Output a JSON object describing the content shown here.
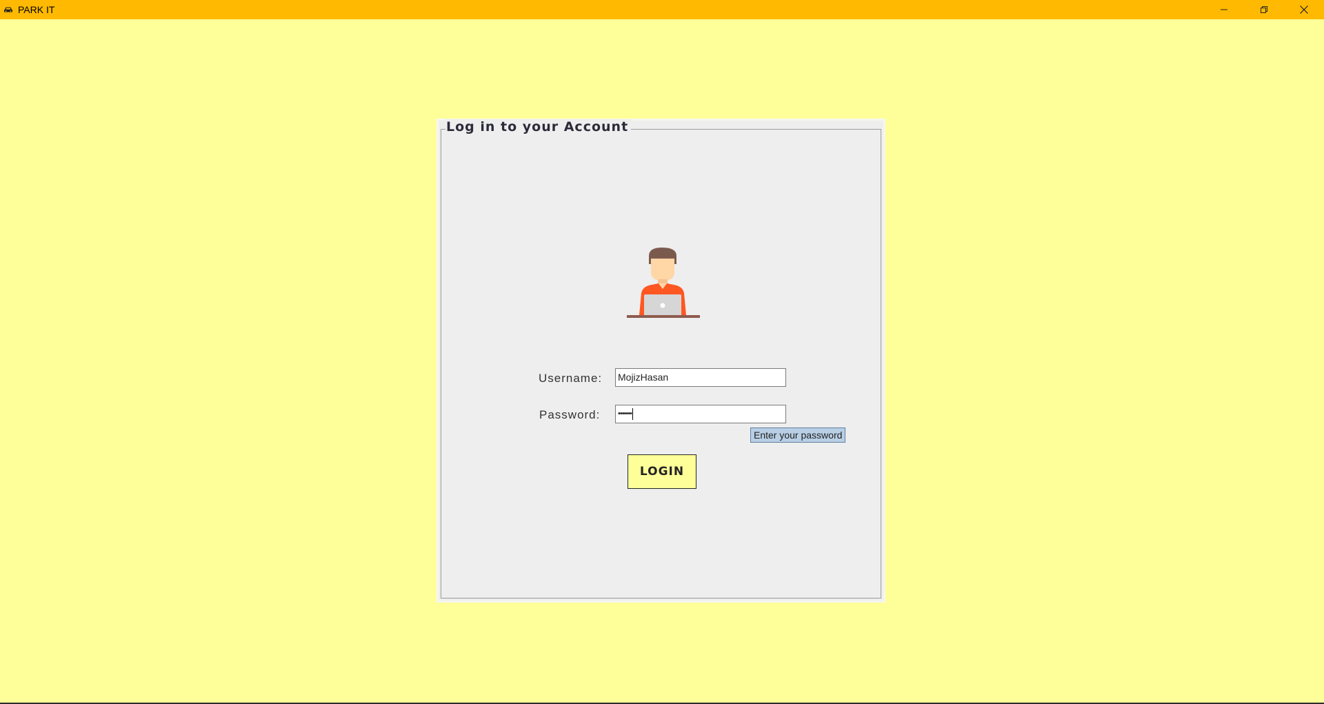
{
  "window": {
    "title": "PARK IT",
    "app_icon": "car-icon",
    "controls": [
      "minimize-icon",
      "restore-icon",
      "close-icon"
    ]
  },
  "login_panel": {
    "title": "Log in to your Account",
    "avatar": "user-at-laptop-icon",
    "username_label": "Username:",
    "username_value": "MojizHasan",
    "password_label": "Password:",
    "password_value": "•••••••",
    "password_tooltip": "Enter your password",
    "login_button": "LOGIN"
  },
  "colors": {
    "background": "#ffff99",
    "titlebar": "#ffb900",
    "panel": "#eeeeee",
    "login_button": "#ffff99",
    "tooltip": "#b8cfe5",
    "avatar_shirt": "#ff5722"
  }
}
